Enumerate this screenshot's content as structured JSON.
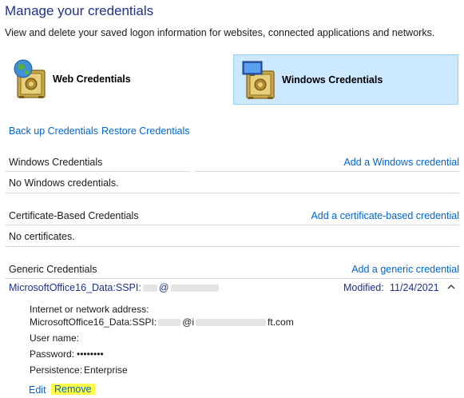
{
  "header": {
    "title": "Manage your credentials",
    "subtitle": "View and delete your saved logon information for websites, connected applications and networks."
  },
  "credential_types": {
    "web": "Web Credentials",
    "windows": "Windows Credentials",
    "selected": "windows"
  },
  "actions": {
    "backup": "Back up Credentials",
    "restore": "Restore Credentials"
  },
  "sections": {
    "windows": {
      "title": "Windows Credentials",
      "add_link": "Add a Windows credential",
      "empty_text": "No Windows credentials."
    },
    "certificate": {
      "title": "Certificate-Based Credentials",
      "add_link": "Add a certificate-based credential",
      "empty_text": "No certificates."
    },
    "generic": {
      "title": "Generic Credentials",
      "add_link": "Add a generic credential"
    }
  },
  "entry": {
    "name_start": "MicrosoftOffice16_Data:SSPI:",
    "name_mid": "@",
    "modified_label": "Modified:",
    "modified_date": "11/24/2021",
    "address_label": "Internet or network address:",
    "address_start": "MicrosoftOffice16_Data:SSPI:",
    "address_mid": "@i",
    "address_end": "ft.com",
    "user_label": "User name:",
    "password_label": "Password:",
    "password_value": "••••••••",
    "persistence_label": "Persistence:",
    "persistence_value": "Enterprise",
    "edit": "Edit",
    "remove": "Remove"
  },
  "colors": {
    "title": "#1e3287",
    "link": "#0066cc",
    "selected_tile": "#cce8ff",
    "highlight": "#ffff4a"
  }
}
